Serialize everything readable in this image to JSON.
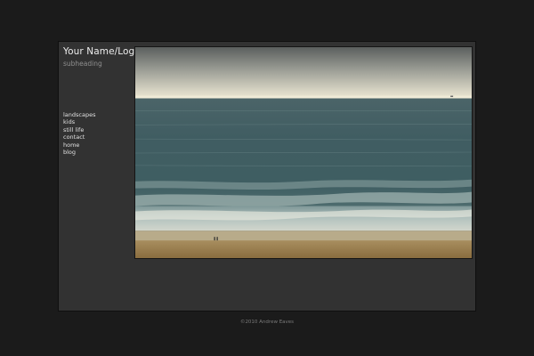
{
  "header": {
    "logo_text": "Your Name/Logo",
    "subheading": "subheading"
  },
  "nav": {
    "items": [
      {
        "label": "landscapes"
      },
      {
        "label": "kids"
      },
      {
        "label": "still life"
      },
      {
        "label": "contact"
      },
      {
        "label": "home"
      },
      {
        "label": "blog"
      }
    ]
  },
  "footer": {
    "copyright": "©2010 Andrew Eaves"
  },
  "colors": {
    "page_background": "#1b1b1b",
    "panel_background": "#323232",
    "logo_text": "#ececec",
    "subheading_text": "#8f8f8f",
    "nav_text": "#e0e0e0",
    "footer_text": "#7a7a7a"
  }
}
